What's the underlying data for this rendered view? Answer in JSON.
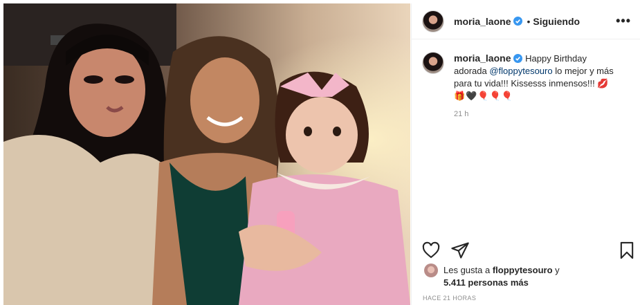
{
  "post": {
    "username": "moria_laone",
    "dot": "•",
    "follow_status": "Siguiendo",
    "more": "•••",
    "caption": {
      "username": "moria_laone",
      "text_before": "Happy Birthday adorada",
      "mention": "@floppytesouro",
      "text_after": "lo mejor y más para tu vida!!! Kissesss inmensos!!!",
      "emojis": "💋🎁🖤🎈🎈🎈"
    },
    "caption_time": "21 h",
    "likes": {
      "prefix": "Les gusta a",
      "user": "floppytesouro",
      "and": "y",
      "count": "5.411 personas más"
    },
    "timestamp": "HACE 21 HORAS"
  },
  "icons": {
    "like": "heart-icon",
    "share": "send-icon",
    "save": "bookmark-icon",
    "verified": "verified-badge-icon"
  },
  "colors": {
    "verified": "#3897f0",
    "mention": "#00376b",
    "muted": "#8e8e8e",
    "border": "#efefef"
  }
}
